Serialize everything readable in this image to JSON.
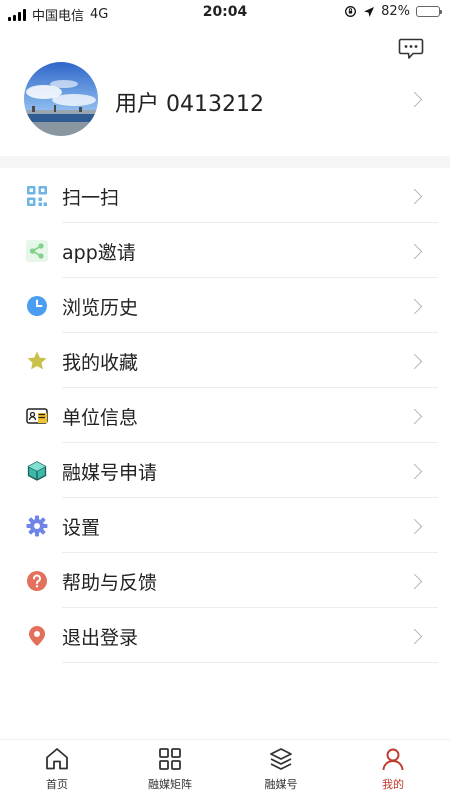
{
  "status_bar": {
    "carrier": "中国电信",
    "network": "4G",
    "time": "20:04",
    "battery_percent": "82%",
    "battery_level": 0.82
  },
  "header": {
    "message_icon": "message-dots-icon"
  },
  "profile": {
    "username": "用户 0413212"
  },
  "menu": {
    "items": [
      {
        "label": "扫一扫",
        "icon": "qr-scan-icon",
        "color": "#6fb6e6"
      },
      {
        "label": "app邀请",
        "icon": "share-icon",
        "color": "#7fd28a"
      },
      {
        "label": "浏览历史",
        "icon": "clock-icon",
        "color": "#4a9ef0"
      },
      {
        "label": "我的收藏",
        "icon": "star-icon",
        "color": "#c8c24a"
      },
      {
        "label": "单位信息",
        "icon": "id-card-icon",
        "color": "#f1c232"
      },
      {
        "label": "融媒号申请",
        "icon": "cube-icon",
        "color": "#3cb9a9"
      },
      {
        "label": "设置",
        "icon": "gear-icon",
        "color": "#6f86e8"
      },
      {
        "label": "帮助与反馈",
        "icon": "question-icon",
        "color": "#e2705a"
      },
      {
        "label": "退出登录",
        "icon": "location-pin-icon",
        "color": "#e2705a"
      }
    ]
  },
  "tab_bar": {
    "active_color": "#c0392b",
    "tabs": [
      {
        "label": "首页",
        "icon": "home-icon",
        "active": false
      },
      {
        "label": "融媒矩阵",
        "icon": "grid-icon",
        "active": false
      },
      {
        "label": "融媒号",
        "icon": "layers-icon",
        "active": false
      },
      {
        "label": "我的",
        "icon": "user-icon",
        "active": true
      }
    ]
  }
}
